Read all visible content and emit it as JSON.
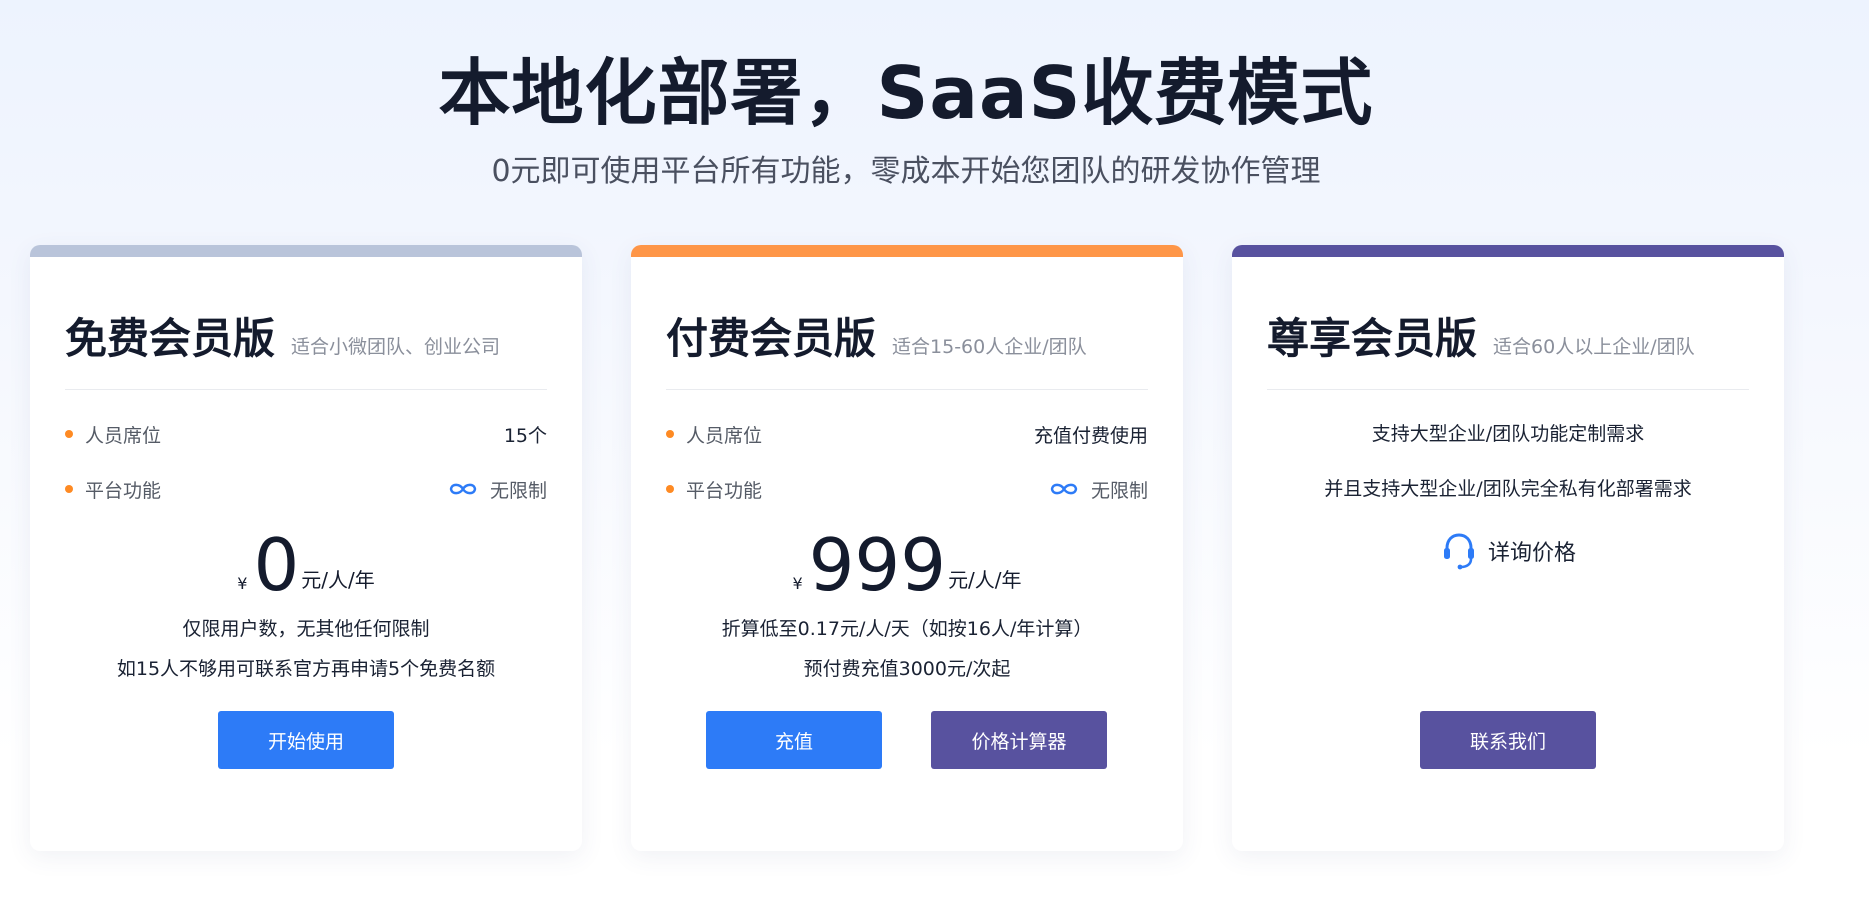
{
  "hero": {
    "title": "本地化部署，SaaS收费模式",
    "subtitle": "0元即可使用平台所有功能，零成本开始您团队的研发协作管理"
  },
  "colors": {
    "accent_blue": "#2d7bf7",
    "accent_purple": "#58529f",
    "accent_orange": "#fe9648",
    "accent_gray": "#b9c4da"
  },
  "plans": [
    {
      "name": "免费会员版",
      "desc": "适合小微团队、创业公司",
      "features": [
        {
          "label": "人员席位",
          "value": "15个"
        },
        {
          "label": "平台功能",
          "value": "无限制",
          "icon": "infinity-icon"
        }
      ],
      "price": {
        "currency": "¥",
        "amount": "0",
        "unit": "元/人/年"
      },
      "notes": [
        "仅限用户数，无其他任何限制",
        "如15人不够用可联系官方再申请5个免费名额"
      ],
      "buttons": [
        "开始使用"
      ]
    },
    {
      "name": "付费会员版",
      "desc": "适合15-60人企业/团队",
      "features": [
        {
          "label": "人员席位",
          "value": "充值付费使用"
        },
        {
          "label": "平台功能",
          "value": "无限制",
          "icon": "infinity-icon"
        }
      ],
      "price": {
        "currency": "¥",
        "amount": "999",
        "unit": "元/人/年"
      },
      "notes": [
        "折算低至0.17元/人/天（如按16人/年计算）",
        "预付费充值3000元/次起"
      ],
      "buttons": [
        "充值",
        "价格计算器"
      ]
    },
    {
      "name": "尊享会员版",
      "desc": "适合60人以上企业/团队",
      "lines": [
        "支持大型企业/团队功能定制需求",
        "并且支持大型企业/团队完全私有化部署需求"
      ],
      "inquiry": {
        "label": "详询价格",
        "icon": "headset-icon"
      },
      "buttons": [
        "联系我们"
      ]
    }
  ]
}
